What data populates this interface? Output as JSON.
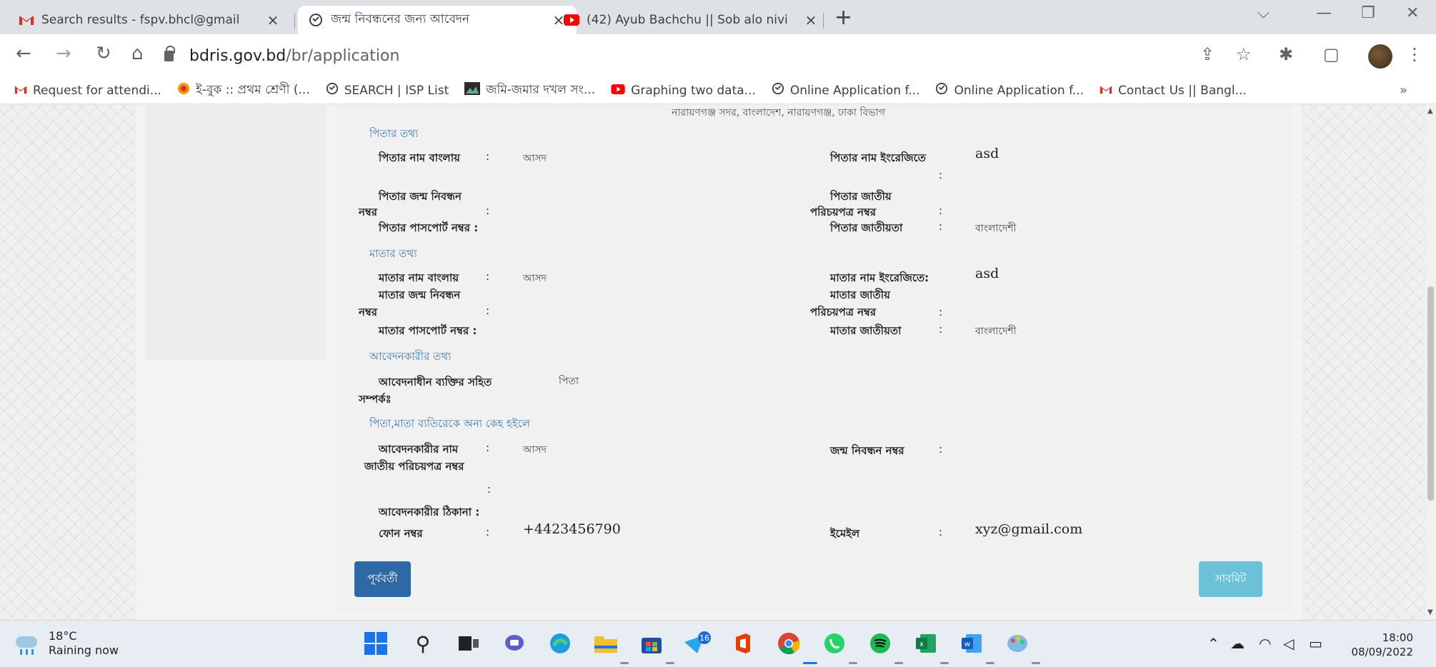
{
  "browser": {
    "tabs": [
      {
        "title": "Search results - fspv.bhcl@gmail",
        "icon": "gmail-icon",
        "active": false
      },
      {
        "title": "জন্ম নিবন্ধনের জন্য আবেদন",
        "icon": "globe-icon",
        "active": true
      },
      {
        "title": "(42) Ayub Bachchu || Sob alo nivi",
        "icon": "youtube-icon",
        "active": false
      }
    ],
    "close_glyph": "×",
    "new_tab_glyph": "+",
    "url_host": "bdris.gov.bd",
    "url_path": "/br/application",
    "bookmarks": [
      {
        "label": "Request for attendi...",
        "icon": "gmail-icon"
      },
      {
        "label": "ই-বুক :: প্রথম শ্রেণী (...",
        "icon": "ebook-icon"
      },
      {
        "label": "SEARCH | ISP List",
        "icon": "globe-icon"
      },
      {
        "label": "জমি-জমার দখল সং...",
        "icon": "image-icon"
      },
      {
        "label": "Graphing two data...",
        "icon": "youtube-icon"
      },
      {
        "label": "Online Application f...",
        "icon": "globe-icon"
      },
      {
        "label": "Online Application f...",
        "icon": "globe-icon"
      },
      {
        "label": "Contact Us || Bangl...",
        "icon": "gmail-icon"
      }
    ],
    "bookmarks_more": "»"
  },
  "page": {
    "address_line": "নারায়ণগঞ্জ সদর, বাংলাদেশ, নারায়ণগঞ্জ, ঢাকা বিভাগ",
    "father": {
      "heading": "পিতার তথ্য",
      "name_bn_label": "পিতার নাম বাংলায়",
      "name_bn_value": "আসদ",
      "name_en_label": "পিতার নাম ইংরেজিতে",
      "name_en_value": "asd",
      "brn_label_1": "পিতার জন্ম নিবন্ধন",
      "brn_label_2": "নম্বর",
      "nid_label_1": "পিতার জাতীয়",
      "nid_label_2": "পরিচয়পত্র নম্বর",
      "passport_label": "পিতার পাসপোর্ট নম্বর :",
      "nationality_label": "পিতার জাতীয়তা",
      "nationality_value": "বাংলাদেশী"
    },
    "mother": {
      "heading": "মাতার তথ্য",
      "name_bn_label": "মাতার নাম বাংলায়",
      "name_bn_value": "আসদ",
      "name_en_label": "মাতার নাম ইংরেজিতে:",
      "name_en_value": "asd",
      "brn_label_1": "মাতার জন্ম নিবন্ধন",
      "brn_label_2": "নম্বর",
      "nid_label_1": "মাতার জাতীয়",
      "nid_label_2": "পরিচয়পত্র নম্বর",
      "passport_label": "মাতার পাসপোর্ট নম্বর :",
      "nationality_label": "মাতার জাতীয়তা",
      "nationality_value": "বাংলাদেশী"
    },
    "applicant": {
      "heading": "আবেদনকারীর তথ্য",
      "relation_label_1": "আবেদনাধীন ব্যক্তির সহিত",
      "relation_label_2": "সম্পর্কঃ",
      "relation_value": "পিতা"
    },
    "other": {
      "heading": "পিতা,মাতা ব্যতিরেকে অন্য কেহ হইলে",
      "name_label": "আবেদনকারীর নাম",
      "name_value": "আসদ",
      "brn_label": "জন্ম নিবন্ধন নম্বর",
      "nid_label": "জাতীয় পরিচয়পত্র নম্বর",
      "address_label": "আবেদনকারীর ঠিকানা :",
      "phone_label": "ফোন নম্বর",
      "phone_value": "+4423456790",
      "email_label": "ইমেইল",
      "email_value": "xyz@gmail.com"
    },
    "colon": ":",
    "prev_button": "পূর্ববর্তী",
    "submit_button": "সাবমিট"
  },
  "taskbar": {
    "temperature": "18°C",
    "weather": "Raining now",
    "teams_badge": "16",
    "time": "18:00",
    "date": "08/09/2022"
  },
  "colors": {
    "accent_blue": "#2e69a7",
    "section_heading": "#3a78b5",
    "submit": "#6cc0d8"
  }
}
